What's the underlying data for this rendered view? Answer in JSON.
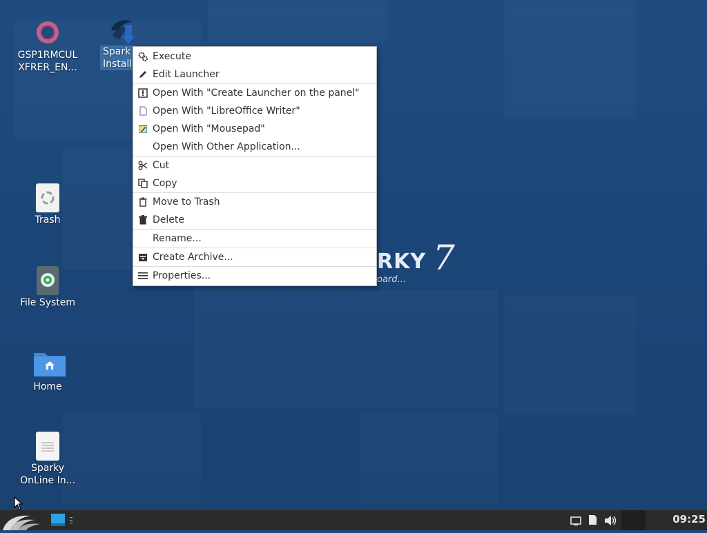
{
  "desktop": {
    "icons": [
      {
        "label": "GSP1RMCUL\nXFRER_EN..."
      },
      {
        "label": "Spark\nInstall"
      },
      {
        "label": "Trash"
      },
      {
        "label": "File System"
      },
      {
        "label": "Home"
      },
      {
        "label": "Sparky\nOnLine In..."
      }
    ],
    "wallpaper": {
      "word": "RKY",
      "seven": "7",
      "tag": "oard..."
    }
  },
  "context_menu": {
    "items": [
      {
        "label": "Execute",
        "icon": "gears-icon"
      },
      {
        "label": "Edit Launcher",
        "icon": "pencil-icon"
      },
      {
        "label": "Open With \"Create Launcher on the panel\"",
        "icon": "launcher-icon"
      },
      {
        "label": "Open With \"LibreOffice Writer\"",
        "icon": "writer-document-icon"
      },
      {
        "label": "Open With \"Mousepad\"",
        "icon": "mousepad-icon"
      },
      {
        "label": "Open With Other Application...",
        "icon": ""
      },
      {
        "label": "Cut",
        "icon": "scissors-icon"
      },
      {
        "label": "Copy",
        "icon": "copy-icon"
      },
      {
        "label": "Move to Trash",
        "icon": "trash-outline-icon"
      },
      {
        "label": "Delete",
        "icon": "trash-filled-icon"
      },
      {
        "label": "Rename...",
        "icon": ""
      },
      {
        "label": "Create Archive...",
        "icon": "archive-icon"
      },
      {
        "label": "Properties...",
        "icon": "list-icon"
      }
    ]
  },
  "taskbar": {
    "clock": "09:25"
  },
  "colors": {
    "desktop_bg": "#1f4c80",
    "menu_bg": "#ffffff",
    "taskbar_bg": "#2b2b2b",
    "selection": "#3a6ea5"
  }
}
